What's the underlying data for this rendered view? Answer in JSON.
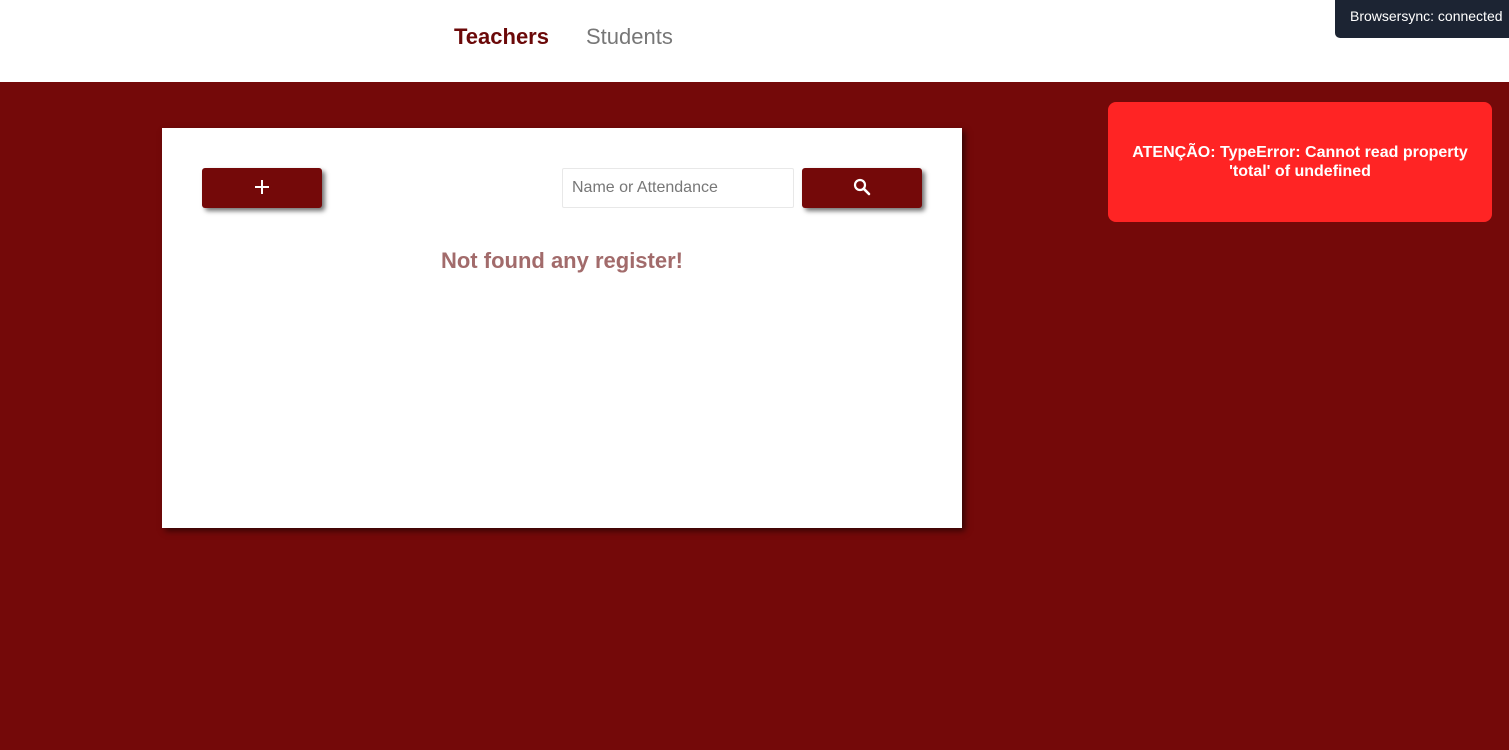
{
  "nav": {
    "items": [
      {
        "label": "Teachers",
        "active": true
      },
      {
        "label": "Students",
        "active": false
      }
    ]
  },
  "browsersync": {
    "text": "Browsersync: connected"
  },
  "toolbar": {
    "add_icon": "plus-icon",
    "search_icon": "magnifier-icon",
    "search_placeholder": "Name or Attendance",
    "search_value": ""
  },
  "content": {
    "empty_message": "Not found any register!"
  },
  "alert": {
    "message": "ATENÇÃO: TypeError: Cannot read property 'total' of undefined"
  },
  "colors": {
    "brand": "#740909",
    "nav_active": "#6b0909",
    "alert_bg": "#ff2424",
    "badge_bg": "#1c2433",
    "empty_text": "#a26b6b"
  }
}
